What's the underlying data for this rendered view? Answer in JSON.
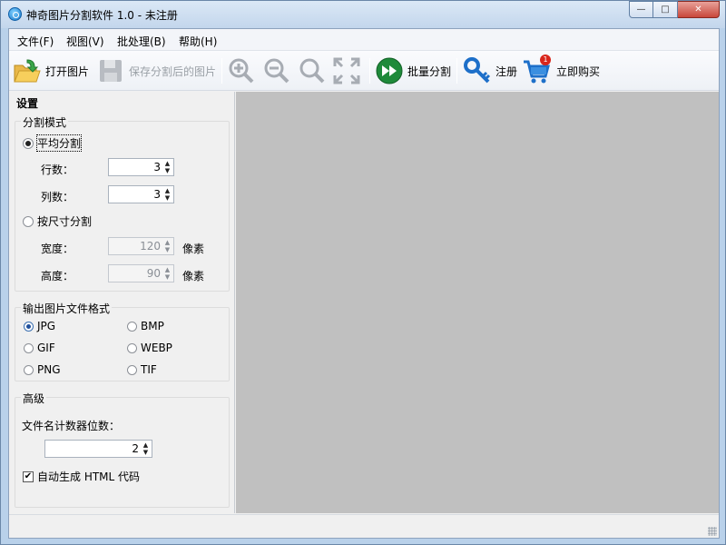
{
  "window": {
    "title": "神奇图片分割软件 1.0 - 未注册",
    "controls": {
      "minimize": "—",
      "maximize": "□",
      "close": "✕"
    }
  },
  "menu": [
    {
      "label": "文件(F)"
    },
    {
      "label": "视图(V)"
    },
    {
      "label": "批处理(B)"
    },
    {
      "label": "帮助(H)"
    }
  ],
  "toolbar": {
    "open_label": "打开图片",
    "save_label": "保存分割后的图片",
    "batch_label": "批量分割",
    "register_label": "注册",
    "buy_label": "立即购买",
    "cart_badge": "1",
    "icons": [
      "folder-open-icon",
      "save-icon",
      "zoom-in-icon",
      "zoom-out-icon",
      "zoom-fit-icon",
      "fullscreen-icon",
      "fast-forward-icon",
      "key-icon",
      "cart-icon"
    ]
  },
  "panel": {
    "title": "设置",
    "split_mode": {
      "title": "分割模式",
      "average_label": "平均分割",
      "rows_label": "行数：",
      "rows_value": "3",
      "cols_label": "列数：",
      "cols_value": "3",
      "by_size_label": "按尺寸分割",
      "width_label": "宽度：",
      "width_value": "120",
      "height_label": "高度：",
      "height_value": "90",
      "unit": "像素"
    },
    "output_format": {
      "title": "输出图片文件格式",
      "options": [
        "JPG",
        "BMP",
        "GIF",
        "WEBP",
        "PNG",
        "TIF"
      ],
      "selected": "JPG"
    },
    "advanced": {
      "title": "高级",
      "counter_label": "文件名计数器位数：",
      "counter_value": "2",
      "html_label": "自动生成 HTML 代码",
      "html_checked": true
    }
  },
  "colors": {
    "canvas": "#c0c0c0",
    "titlebar": "#c3d6ec",
    "accent": "#1f8a3a"
  }
}
